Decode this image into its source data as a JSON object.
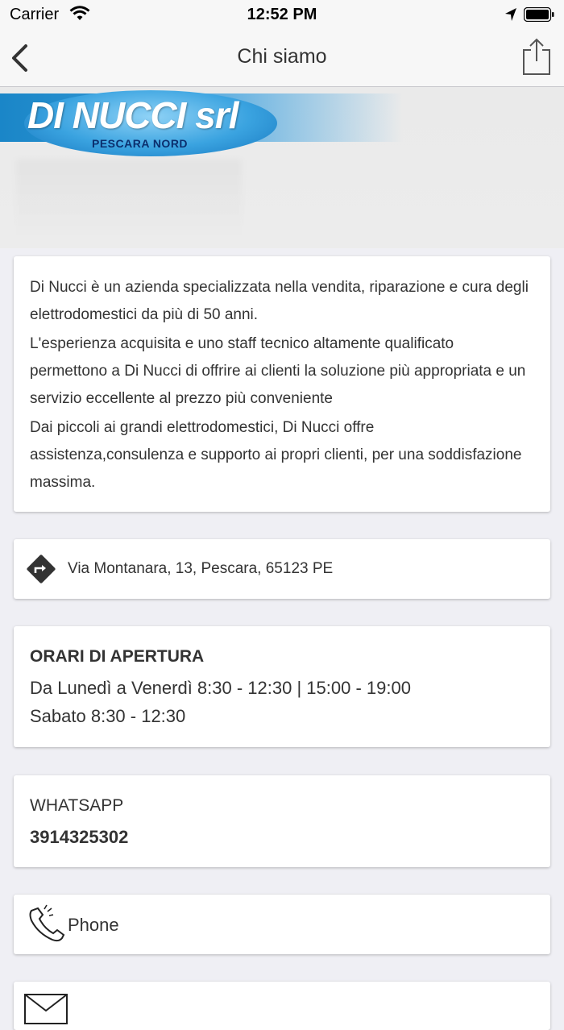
{
  "status_bar": {
    "carrier": "Carrier",
    "time": "12:52 PM"
  },
  "nav": {
    "title": "Chi siamo",
    "back_icon": "chevron-left-icon",
    "share_icon": "share-icon"
  },
  "logo": {
    "name": "DI NUCCI srl",
    "subtitle": "PESCARA NORD"
  },
  "about": {
    "paragraphs": [
      "Di Nucci è un azienda specializzata nella vendita, riparazione e cura degli elettrodomestici da più di 50 anni.",
      "L'esperienza acquisita e uno staff tecnico altamente qualificato permettono a Di Nucci di offrire ai clienti la soluzione più appropriata e un servizio eccellente al prezzo più conveniente",
      "Dai piccoli ai grandi elettrodomestici, Di Nucci offre assistenza,consulenza e supporto ai propri clienti, per una soddisfazione massima."
    ]
  },
  "address": {
    "text": "Via Montanara, 13, Pescara, 65123 PE",
    "icon": "directions-icon"
  },
  "hours": {
    "title": "ORARI DI APERTURA",
    "line1": "Da Lunedì a Venerdì 8:30 - 12:30 | 15:00 - 19:00",
    "line2": "Sabato 8:30 - 12:30"
  },
  "whatsapp": {
    "label": "WHATSAPP",
    "number": "3914325302"
  },
  "phone": {
    "label": "Phone",
    "icon": "phone-icon"
  },
  "email": {
    "icon": "mail-icon"
  },
  "colors": {
    "background": "#efeff4",
    "logo_blue": "#1a86c8",
    "logo_navy": "#0b2f6e",
    "text": "#333333"
  }
}
